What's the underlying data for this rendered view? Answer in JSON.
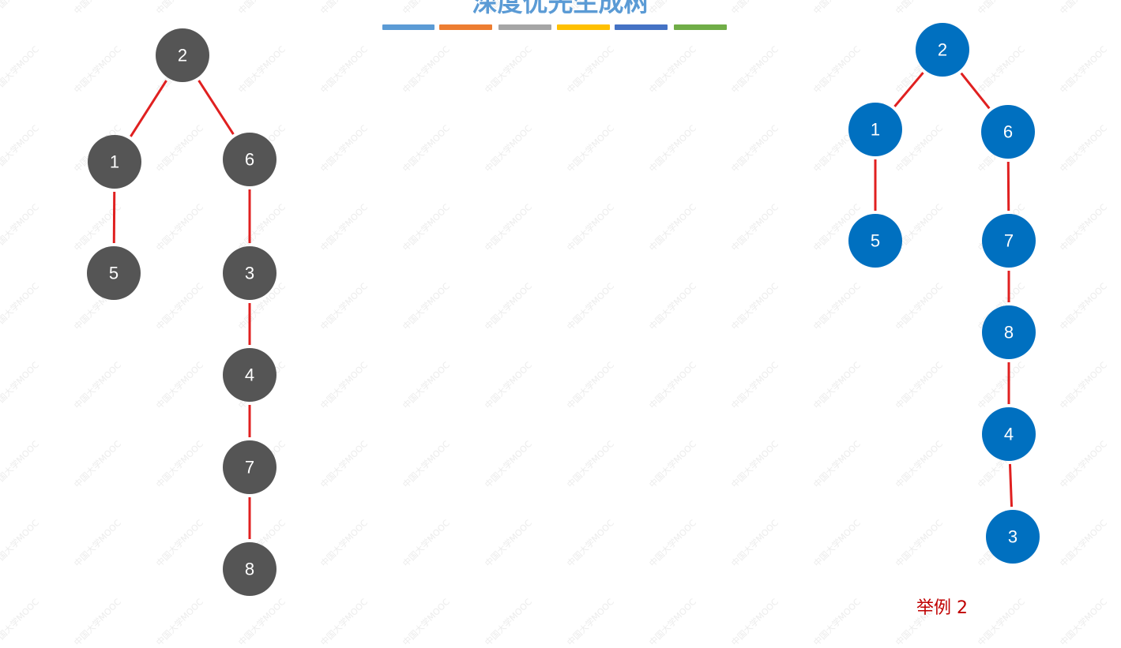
{
  "header": {
    "title": "深度优先生成树",
    "strip_colors": [
      "#5b9bd5",
      "#ed7d31",
      "#a5a5a5",
      "#ffc000",
      "#4472c4",
      "#70ad47"
    ]
  },
  "watermark": {
    "text": "中国大学MOOC"
  },
  "edge_color": "#e02020",
  "trees": [
    {
      "name": "left-tree",
      "node_color": "#555555",
      "nodes": [
        {
          "id": "2"
        },
        {
          "id": "1"
        },
        {
          "id": "6"
        },
        {
          "id": "5"
        },
        {
          "id": "3"
        },
        {
          "id": "4"
        },
        {
          "id": "7"
        },
        {
          "id": "8"
        }
      ],
      "edges": [
        [
          "2",
          "1"
        ],
        [
          "2",
          "6"
        ],
        [
          "1",
          "5"
        ],
        [
          "6",
          "3"
        ],
        [
          "3",
          "4"
        ],
        [
          "4",
          "7"
        ],
        [
          "7",
          "8"
        ]
      ]
    },
    {
      "name": "right-tree",
      "node_color": "#0070c0",
      "nodes": [
        {
          "id": "2"
        },
        {
          "id": "1"
        },
        {
          "id": "6"
        },
        {
          "id": "5"
        },
        {
          "id": "7"
        },
        {
          "id": "8"
        },
        {
          "id": "4"
        },
        {
          "id": "3"
        }
      ],
      "edges": [
        [
          "2",
          "1"
        ],
        [
          "2",
          "6"
        ],
        [
          "1",
          "5"
        ],
        [
          "6",
          "7"
        ],
        [
          "7",
          "8"
        ],
        [
          "8",
          "4"
        ],
        [
          "4",
          "3"
        ]
      ]
    }
  ],
  "footer": {
    "note": "举例 2"
  }
}
